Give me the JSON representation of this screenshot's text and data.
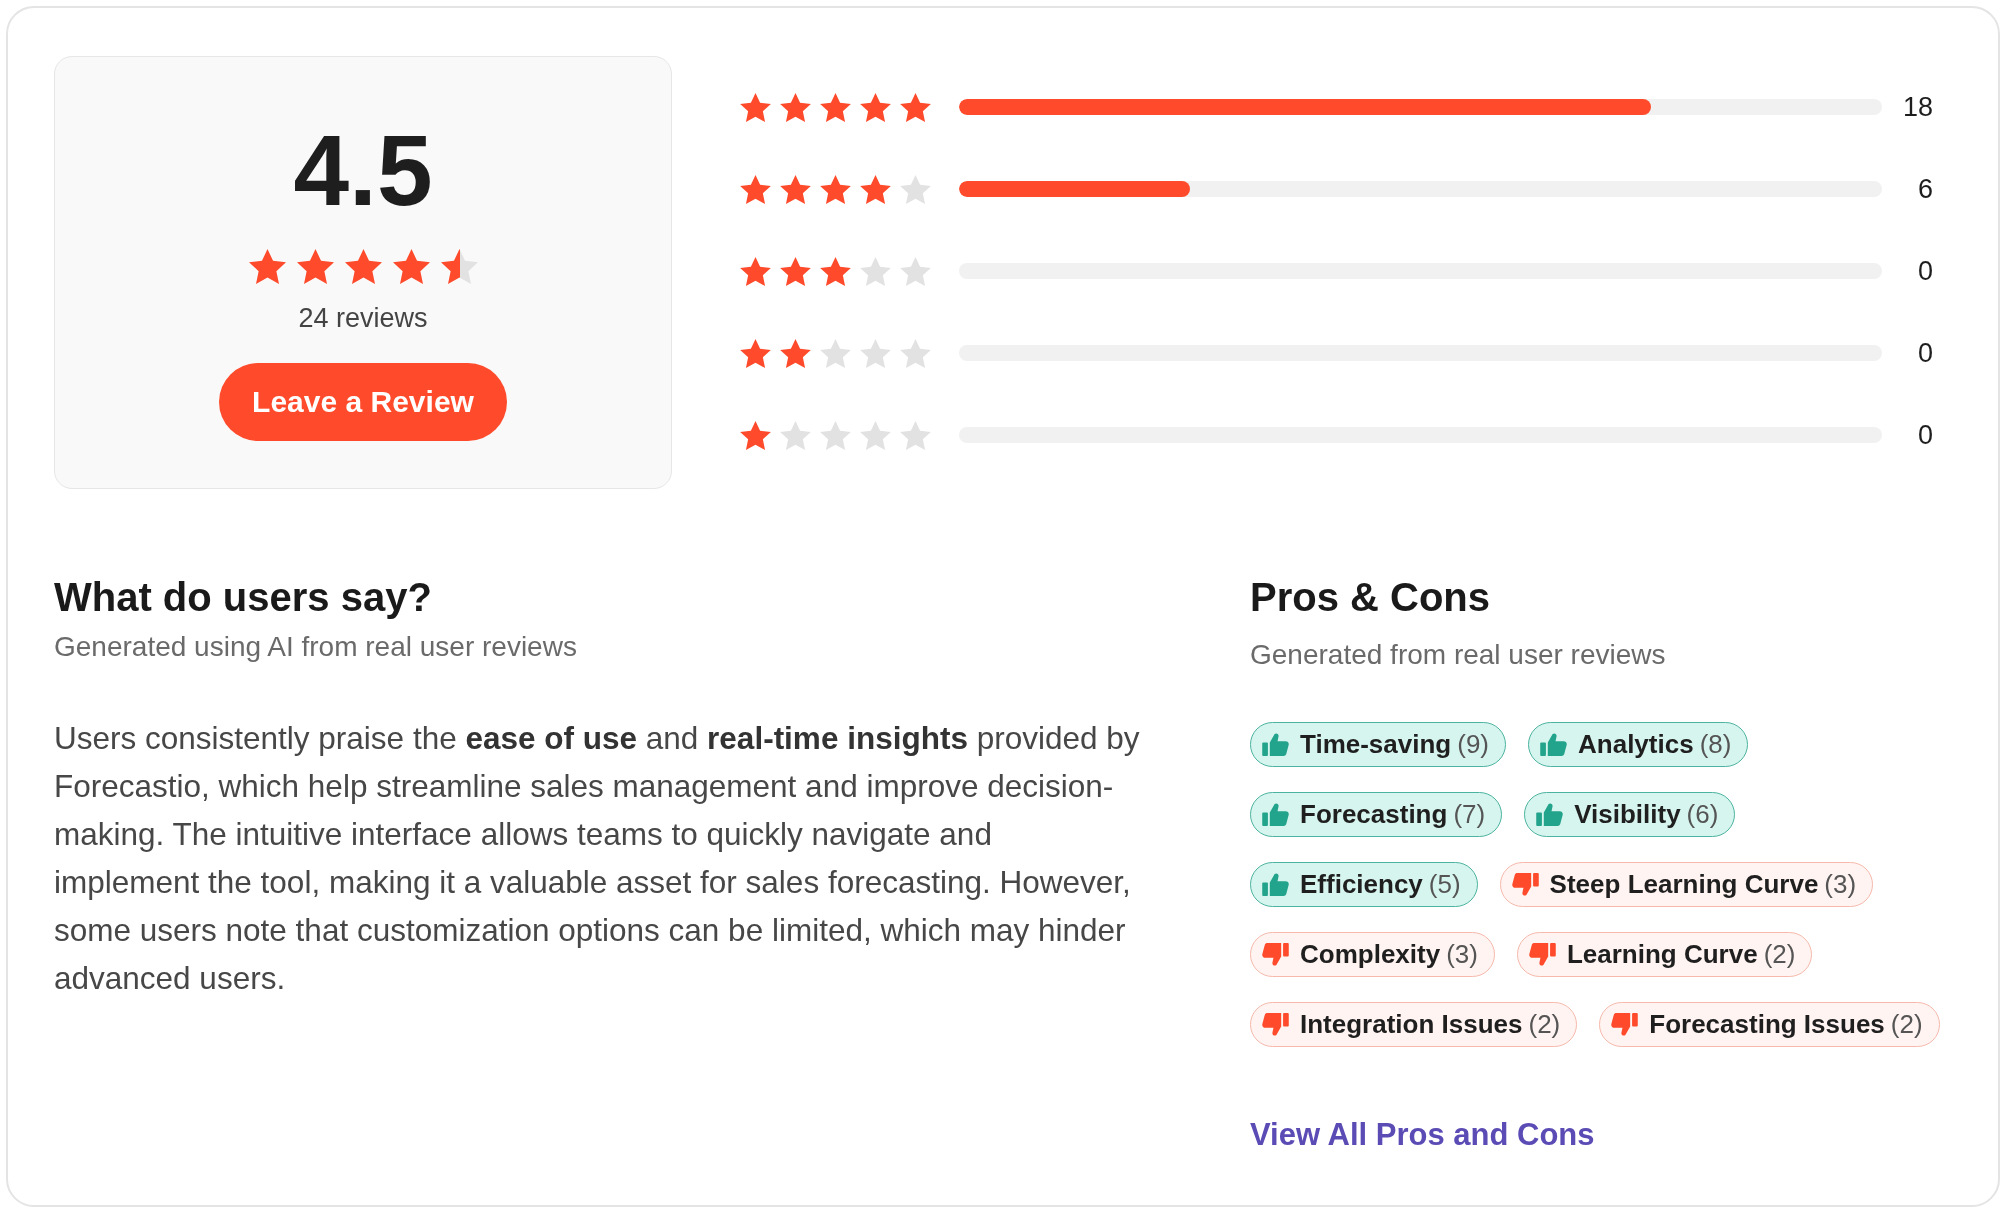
{
  "rating_summary": {
    "score": "4.5",
    "stars": 4.5,
    "review_count": "24 reviews",
    "button": "Leave a Review"
  },
  "rating_breakdown": [
    {
      "stars": 5,
      "level": 0.75,
      "count": "18"
    },
    {
      "stars": 4,
      "level": 0.25,
      "count": "6"
    },
    {
      "stars": 3,
      "count": "0"
    },
    {
      "stars": 2,
      "count": "0"
    },
    {
      "stars": 1,
      "count": "0"
    }
  ],
  "user_summary": {
    "title": "What do users say?",
    "subtitle": "Generated using AI from real user reviews",
    "text": "Users consistently praise the **ease of use** and **real-time insights** provided by Forecastio, which help streamline sales management and improve decision-making. The intuitive interface allows teams to quickly navigate and implement the tool, making it a valuable asset for sales forecasting. However, some users note that customization options can be limited, which may hinder advanced users."
  },
  "pros_cons": {
    "title": "Pros & Cons",
    "subtitle": "Generated from real user reviews",
    "tags": [
      {
        "kind": "pro",
        "label": "Time-saving",
        "count": "(9)"
      },
      {
        "kind": "pro",
        "label": "Analytics",
        "count": "(8)"
      },
      {
        "kind": "pro",
        "label": "Forecasting",
        "count": "(7)"
      },
      {
        "kind": "pro",
        "label": "Visibility",
        "count": "(6)"
      },
      {
        "kind": "pro",
        "label": "Efficiency",
        "count": "(5)"
      },
      {
        "kind": "con",
        "label": "Steep Learning Curve",
        "count": "(3)"
      },
      {
        "kind": "con",
        "label": "Complexity",
        "count": "(3)"
      },
      {
        "kind": "con",
        "label": "Learning Curve",
        "count": "(2)"
      },
      {
        "kind": "con",
        "label": "Integration Issues",
        "count": "(2)"
      },
      {
        "kind": "con",
        "label": "Forecasting Issues",
        "count": "(2)"
      }
    ],
    "link": "View All Pros and Cons"
  }
}
